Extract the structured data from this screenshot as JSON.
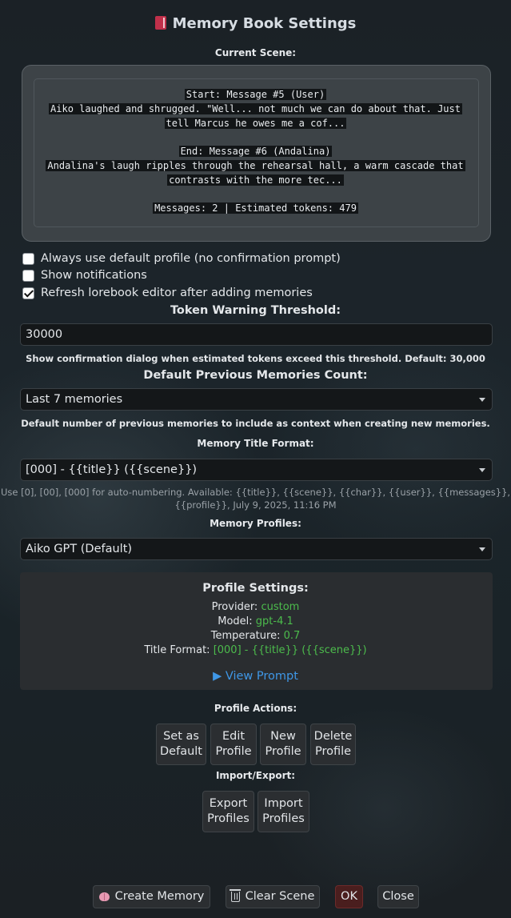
{
  "dialog": {
    "title": "Memory Book Settings",
    "title_icon": "red-book-icon"
  },
  "scene": {
    "label": "Current Scene:",
    "start_header": "Start: Message #5 (User)",
    "start_text_1": "Aiko laughed and shrugged. \"Well... not much we can do about that. Just",
    "start_text_2": "tell Marcus he owes me a cof...",
    "end_header": "End: Message #6 (Andalina)",
    "end_text_1": "Andalina's laugh ripples through the rehearsal hall, a warm cascade that",
    "end_text_2": "contrasts with the more tec...",
    "stats": "Messages: 2 | Estimated tokens: 479"
  },
  "options": [
    {
      "label": "Always use default profile (no confirmation prompt)",
      "checked": false
    },
    {
      "label": "Show notifications",
      "checked": false
    },
    {
      "label": "Refresh lorebook editor after adding memories",
      "checked": true
    }
  ],
  "token_threshold": {
    "label": "Token Warning Threshold:",
    "value": "30000",
    "help": "Show confirmation dialog when estimated tokens exceed this threshold. Default: 30,000"
  },
  "prev_memories": {
    "label": "Default Previous Memories Count:",
    "selected": "Last 7 memories",
    "help": "Default number of previous memories to include as context when creating new memories."
  },
  "title_format": {
    "label": "Memory Title Format:",
    "selected": "[000] - {{title}} ({{scene}})",
    "help_1": "Use [0], [00], [000] for auto-numbering. Available: {{title}}, {{scene}}, {{char}}, {{user}}, {{messages}},",
    "help_2": "{{profile}}, July 9, 2025, 11:16 PM"
  },
  "memory_profiles": {
    "label": "Memory Profiles:",
    "selected": "Aiko GPT (Default)"
  },
  "profile_settings": {
    "heading": "Profile Settings:",
    "provider_label": "Provider:",
    "provider": "custom",
    "model_label": "Model:",
    "model": "gpt-4.1",
    "temperature_label": "Temperature:",
    "temperature": "0.7",
    "title_format_label": "Title Format:",
    "title_format": "[000] - {{title}} ({{scene}})",
    "view_prompt": "▶ View Prompt",
    "value_color": "#4cbc4c",
    "link_color": "#3f97e6"
  },
  "profile_actions": {
    "label": "Profile Actions:",
    "set_default_1": "Set as",
    "set_default_2": "Default",
    "edit_1": "Edit",
    "edit_2": "Profile",
    "new_1": "New",
    "new_2": "Profile",
    "delete_1": "Delete",
    "delete_2": "Profile"
  },
  "import_export": {
    "label": "Import/Export:",
    "export_1": "Export",
    "export_2": "Profiles",
    "import_1": "Import",
    "import_2": "Profiles"
  },
  "footer": {
    "create_memory": "Create Memory",
    "clear_scene": "Clear Scene",
    "ok": "OK",
    "close": "Close"
  }
}
